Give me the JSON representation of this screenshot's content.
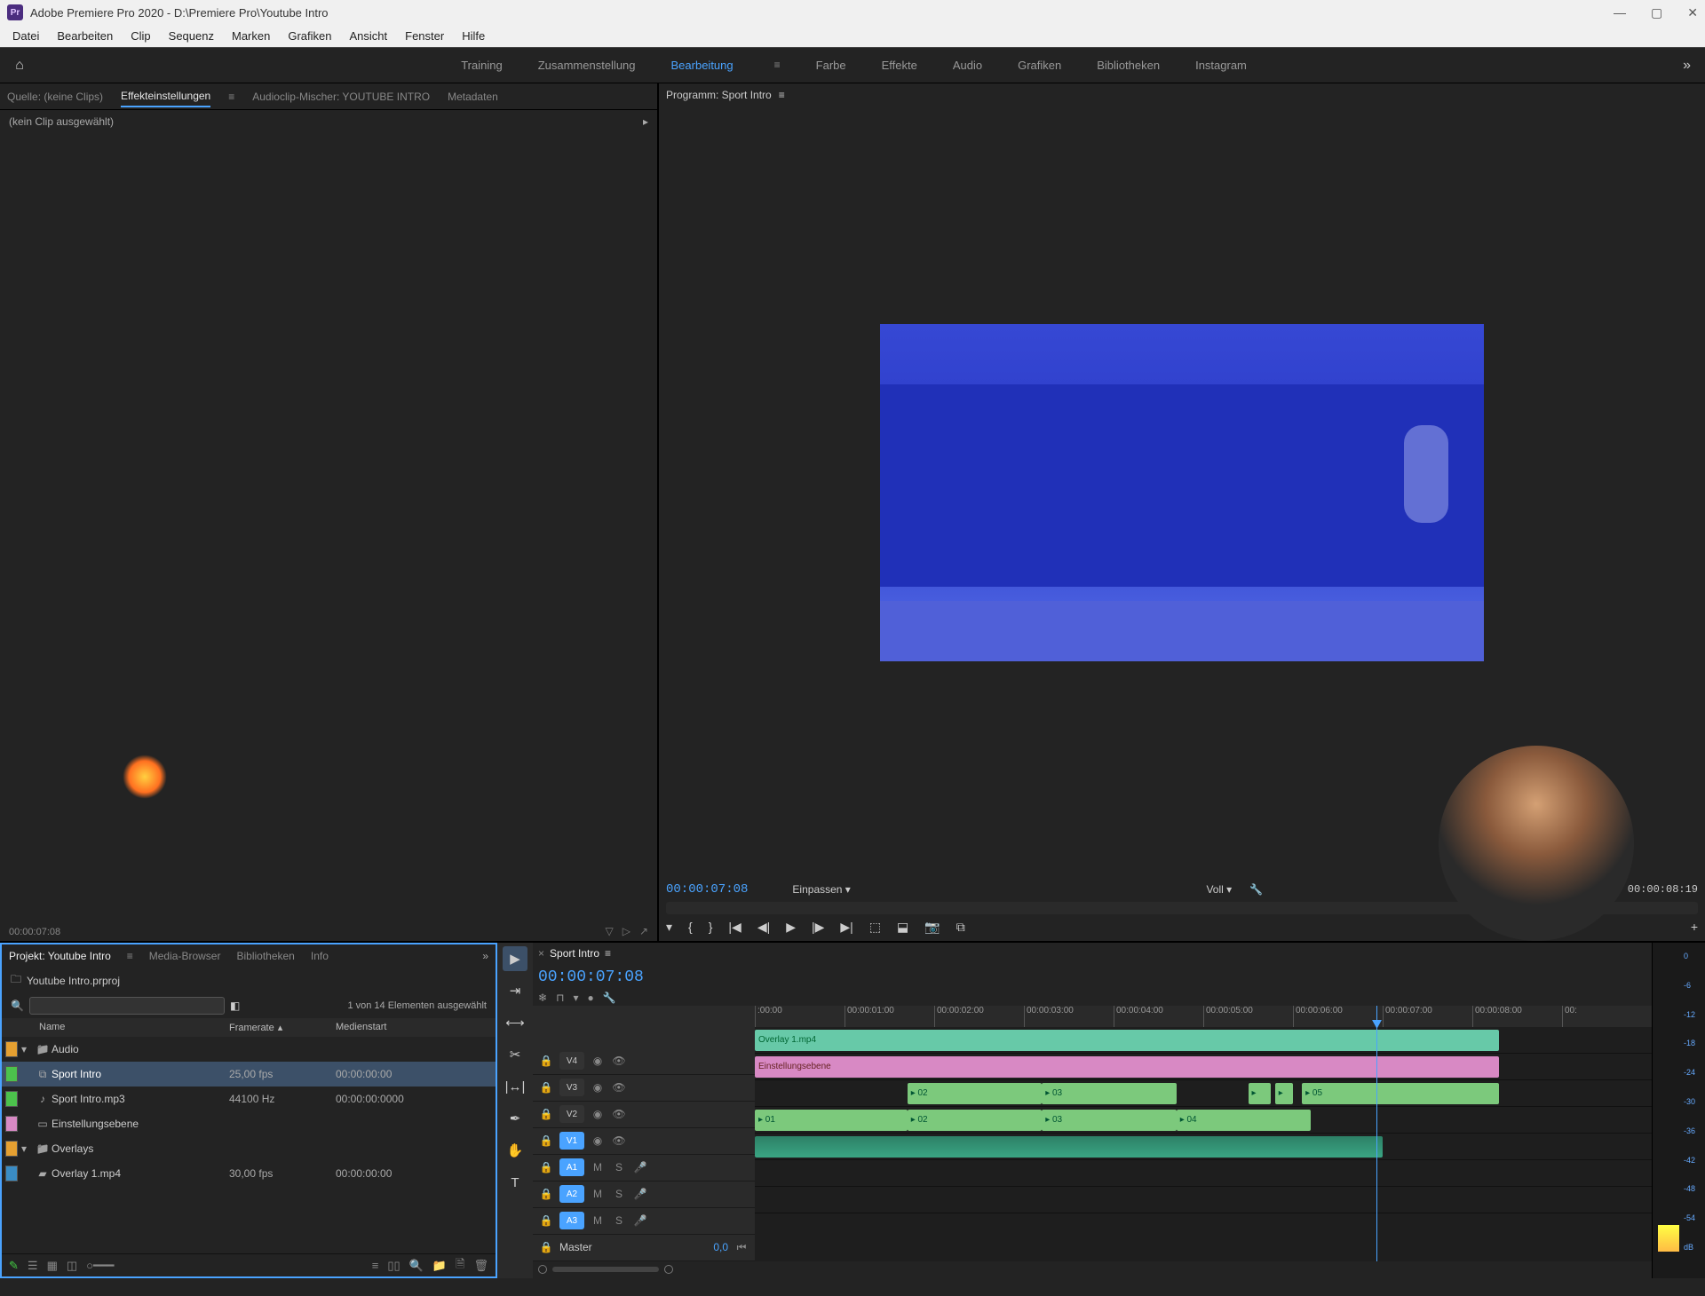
{
  "title": "Adobe Premiere Pro 2020 - D:\\Premiere Pro\\Youtube Intro",
  "menu": [
    "Datei",
    "Bearbeiten",
    "Clip",
    "Sequenz",
    "Marken",
    "Grafiken",
    "Ansicht",
    "Fenster",
    "Hilfe"
  ],
  "workspaces": [
    "Training",
    "Zusammenstellung",
    "Bearbeitung",
    "Farbe",
    "Effekte",
    "Audio",
    "Grafiken",
    "Bibliotheken",
    "Instagram"
  ],
  "active_ws": "Bearbeitung",
  "source_tabs": [
    "Quelle: (keine Clips)",
    "Effekteinstellungen",
    "Audioclip-Mischer: YOUTUBE INTRO",
    "Metadaten"
  ],
  "active_source_tab": "Effekteinstellungen",
  "no_clip_text": "(kein Clip ausgewählt)",
  "source_tc": "00:00:07:08",
  "program": {
    "tab": "Programm: Sport Intro",
    "tc": "00:00:07:08",
    "zoom": "Einpassen",
    "full": "Voll",
    "duration": "00:00:08:19"
  },
  "project": {
    "tabs": [
      "Projekt: Youtube Intro",
      "Media-Browser",
      "Bibliotheken",
      "Info"
    ],
    "active_tab": "Projekt: Youtube Intro",
    "filename": "Youtube Intro.prproj",
    "count_text": "1 von 14 Elementen ausgewählt",
    "columns": {
      "name": "Name",
      "fps": "Framerate",
      "start": "Medienstart"
    },
    "rows": [
      {
        "chip": "#e5a031",
        "disc": "▾",
        "icon": "bin",
        "name": "Audio",
        "fps": "",
        "start": ""
      },
      {
        "chip": "#4cc24c",
        "disc": "",
        "icon": "seq",
        "name": "Sport Intro",
        "fps": "25,00 fps",
        "start": "00:00:00:00",
        "sel": true
      },
      {
        "chip": "#4cc24c",
        "disc": "",
        "icon": "audio",
        "name": "Sport Intro.mp3",
        "fps": "44100 Hz",
        "start": "00:00:00:0000"
      },
      {
        "chip": "#d889c4",
        "disc": "",
        "icon": "adj",
        "name": "Einstellungsebene",
        "fps": "",
        "start": ""
      },
      {
        "chip": "#e5a031",
        "disc": "▾",
        "icon": "bin",
        "name": "Overlays",
        "fps": "",
        "start": ""
      },
      {
        "chip": "#3a8cc4",
        "disc": "",
        "icon": "video",
        "name": "Overlay 1.mp4",
        "fps": "30,00 fps",
        "start": "00:00:00:00"
      }
    ]
  },
  "timeline": {
    "sequence": "Sport Intro",
    "tc": "00:00:07:08",
    "ticks": [
      ":00:00",
      "00:00:01:00",
      "00:00:02:00",
      "00:00:03:00",
      "00:00:04:00",
      "00:00:05:00",
      "00:00:06:00",
      "00:00:07:00",
      "00:00:08:00",
      "00:"
    ],
    "vtracks": [
      {
        "lbl": "V4",
        "sel": false
      },
      {
        "lbl": "V3",
        "sel": false
      },
      {
        "lbl": "V2",
        "sel": false
      },
      {
        "lbl": "V1",
        "sel": true
      }
    ],
    "atracks": [
      {
        "lbl": "A1",
        "sel": true
      },
      {
        "lbl": "A2",
        "sel": true
      },
      {
        "lbl": "A3",
        "sel": true
      }
    ],
    "master": "Master",
    "master_val": "0,0",
    "clips": {
      "v4": {
        "name": "Overlay 1.mp4"
      },
      "v3": {
        "name": "Einstellungsebene"
      },
      "v2": [
        {
          "n": "02",
          "l": 17,
          "w": 15
        },
        {
          "n": "03",
          "l": 32,
          "w": 15
        },
        {
          "n": "",
          "l": 55,
          "w": 2.5
        },
        {
          "n": "",
          "l": 58,
          "w": 2
        },
        {
          "n": "05",
          "l": 61,
          "w": 22
        }
      ],
      "v1": [
        {
          "n": "01",
          "l": 0,
          "w": 17
        },
        {
          "n": "02",
          "l": 17,
          "w": 15
        },
        {
          "n": "03",
          "l": 32,
          "w": 15
        },
        {
          "n": "04",
          "l": 47,
          "w": 15
        }
      ]
    }
  },
  "meters": [
    "0",
    "-6",
    "-12",
    "-18",
    "-24",
    "-30",
    "-36",
    "-42",
    "-48",
    "-54",
    "dB"
  ]
}
